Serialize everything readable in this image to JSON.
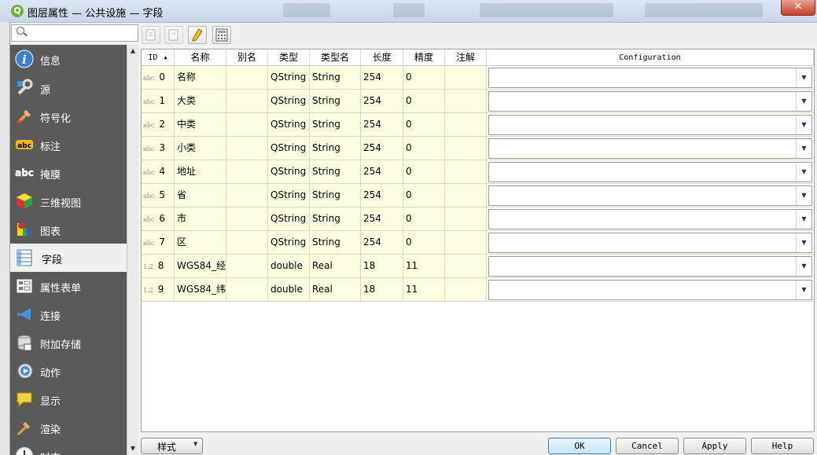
{
  "window": {
    "title": "图层属性 — 公共设施 — 字段",
    "app_icon": "Q",
    "close_label": "✕"
  },
  "search": {
    "placeholder": ""
  },
  "sidebar": {
    "items": [
      {
        "label": "信息",
        "icon": "info-icon"
      },
      {
        "label": "源",
        "icon": "source-wrench-icon"
      },
      {
        "label": "符号化",
        "icon": "symbology-paintbrush-icon"
      },
      {
        "label": "标注",
        "icon": "labels-abc-icon"
      },
      {
        "label": "掩膜",
        "icon": "mask-abc-icon"
      },
      {
        "label": "三维视图",
        "icon": "3d-cube-icon"
      },
      {
        "label": "图表",
        "icon": "diagram-icon"
      },
      {
        "label": "字段",
        "icon": "fields-table-icon",
        "active": true
      },
      {
        "label": "属性表单",
        "icon": "attributes-form-icon"
      },
      {
        "label": "连接",
        "icon": "joins-icon"
      },
      {
        "label": "附加存储",
        "icon": "auxiliary-storage-icon"
      },
      {
        "label": "动作",
        "icon": "actions-icon"
      },
      {
        "label": "显示",
        "icon": "display-tooltip-icon"
      },
      {
        "label": "渲染",
        "icon": "rendering-brush-icon"
      },
      {
        "label": "时态",
        "icon": "temporal-clock-icon"
      }
    ]
  },
  "toolbar": {
    "buttons": [
      {
        "name": "new-field-button",
        "icon": "new-field-icon",
        "enabled": false
      },
      {
        "name": "delete-field-button",
        "icon": "delete-field-icon",
        "enabled": false
      },
      {
        "name": "toggle-editing-button",
        "icon": "pencil-icon",
        "enabled": true
      },
      {
        "name": "field-calculator-button",
        "icon": "calculator-icon",
        "enabled": true
      }
    ]
  },
  "table": {
    "columns": [
      "ID",
      "名称",
      "别名",
      "类型",
      "类型名",
      "长度",
      "精度",
      "注解",
      "Configuration"
    ],
    "rows": [
      {
        "type_icon": "abc",
        "id": "0",
        "name": "名称",
        "alias": "",
        "type": "QString",
        "type_name": "String",
        "length": "254",
        "precision": "0",
        "comment": ""
      },
      {
        "type_icon": "abc",
        "id": "1",
        "name": "大类",
        "alias": "",
        "type": "QString",
        "type_name": "String",
        "length": "254",
        "precision": "0",
        "comment": ""
      },
      {
        "type_icon": "abc",
        "id": "2",
        "name": "中类",
        "alias": "",
        "type": "QString",
        "type_name": "String",
        "length": "254",
        "precision": "0",
        "comment": ""
      },
      {
        "type_icon": "abc",
        "id": "3",
        "name": "小类",
        "alias": "",
        "type": "QString",
        "type_name": "String",
        "length": "254",
        "precision": "0",
        "comment": ""
      },
      {
        "type_icon": "abc",
        "id": "4",
        "name": "地址",
        "alias": "",
        "type": "QString",
        "type_name": "String",
        "length": "254",
        "precision": "0",
        "comment": ""
      },
      {
        "type_icon": "abc",
        "id": "5",
        "name": "省",
        "alias": "",
        "type": "QString",
        "type_name": "String",
        "length": "254",
        "precision": "0",
        "comment": ""
      },
      {
        "type_icon": "abc",
        "id": "6",
        "name": "市",
        "alias": "",
        "type": "QString",
        "type_name": "String",
        "length": "254",
        "precision": "0",
        "comment": ""
      },
      {
        "type_icon": "abc",
        "id": "7",
        "name": "区",
        "alias": "",
        "type": "QString",
        "type_name": "String",
        "length": "254",
        "precision": "0",
        "comment": ""
      },
      {
        "type_icon": "1.2",
        "id": "8",
        "name": "WGS84_经",
        "alias": "",
        "type": "double",
        "type_name": "Real",
        "length": "18",
        "precision": "11",
        "comment": ""
      },
      {
        "type_icon": "1.2",
        "id": "9",
        "name": "WGS84_纬",
        "alias": "",
        "type": "double",
        "type_name": "Real",
        "length": "18",
        "precision": "11",
        "comment": ""
      }
    ]
  },
  "footer": {
    "style_label": "样式",
    "ok_label": "OK",
    "cancel_label": "Cancel",
    "apply_label": "Apply",
    "help_label": "Help"
  },
  "colors": {
    "sidebar_bg": "#5a5a5a",
    "row_bg": "#ffffe1",
    "titlebar": "#c7d6e8"
  }
}
